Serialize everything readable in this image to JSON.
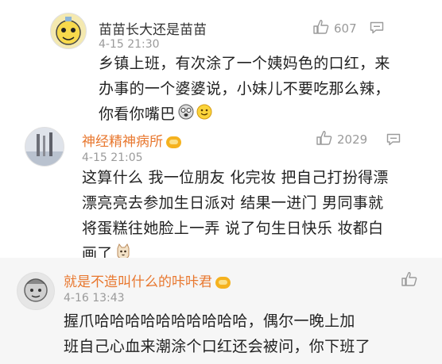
{
  "comments": [
    {
      "username": "苗苗长大还是苗苗",
      "time": "4-15 21:30",
      "likes": "607",
      "lines": [
        "乡镇上班，有次涂了一个姨妈色的口红，来",
        "办事的一个婆婆说，小妹儿不要吃那么辣，",
        "你看你嘴巴"
      ],
      "emojis": [
        "dizzy-face-emoji",
        "smile-emoji"
      ]
    },
    {
      "username": "神经精神病所",
      "time": "4-15 21:05",
      "likes": "2029",
      "lines": [
        "这算什么 我一位朋友 化完妆 把自己打扮得漂",
        "漂亮亮去参加生日派对 结果一进门 男同事就",
        "将蛋糕往她脸上一弄 说了句生日快乐 妆都白",
        "画了"
      ],
      "emojis": [
        "cat-emoji"
      ]
    },
    {
      "username": "就是不造叫什么的咔咔君",
      "time": "4-16 13:43",
      "lines": [
        "握爪哈哈哈哈哈哈哈哈哈哈，偶尔一晚上加",
        "班自己心血来潮涂个口红还会被问，你下班了"
      ]
    }
  ],
  "colors": {
    "vip_name": "#e8772e",
    "normal_name": "#333333",
    "meta": "#9a9a9a",
    "badge": "#f5b21f",
    "highlight_bg": "#f6f6f6"
  },
  "icons": {
    "like": "thumbs-up-icon",
    "reply": "comment-icon",
    "vip": "vip-badge-icon"
  }
}
